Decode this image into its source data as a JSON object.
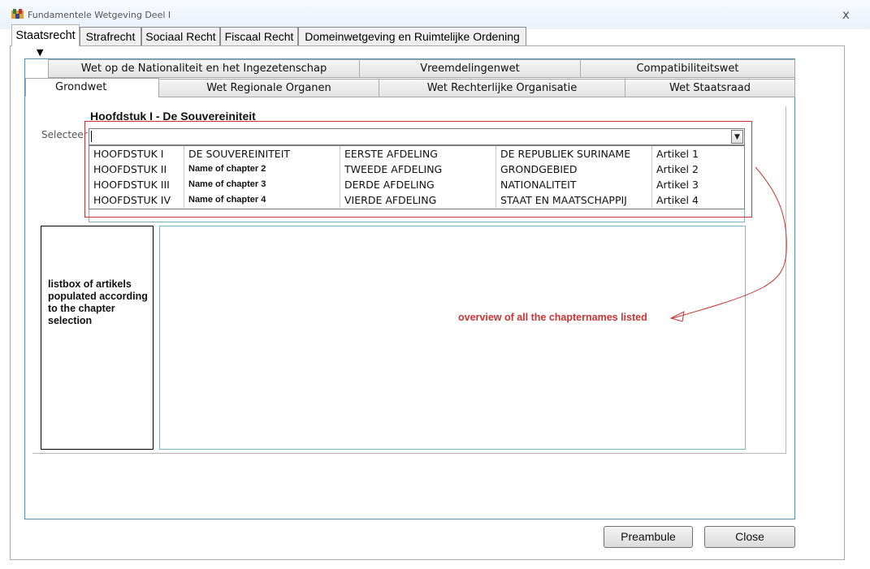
{
  "window": {
    "title": "Fundamentele Wetgeving Deel I",
    "close_glyph": "x"
  },
  "main_tabs": [
    {
      "label": "Staatsrecht"
    },
    {
      "label": "Strafrecht"
    },
    {
      "label": "Sociaal Recht"
    },
    {
      "label": "Fiscaal Recht"
    },
    {
      "label": "Domeinwetgeving en Ruimtelijke Ordening"
    }
  ],
  "arrow_glyph": "▼",
  "sub_tabs_row1": [
    {
      "label": "Wet op de Nationaliteit en het Ingezetenschap"
    },
    {
      "label": "Vreemdelingenwet"
    },
    {
      "label": "Compatibiliteitswet"
    }
  ],
  "sub_tabs_row2": [
    {
      "label": "Grondwet"
    },
    {
      "label": "Wet Regionale Organen"
    },
    {
      "label": "Wet Rechterlijke Organisatie"
    },
    {
      "label": "Wet Staatsraad"
    }
  ],
  "chapter_heading": "Hoofdstuk I - De Souvereiniteit",
  "select_label": "Selecteer",
  "combo_button_glyph": "▼",
  "dropdown_rows": [
    [
      "HOOFDSTUK I",
      "DE SOUVEREINITEIT",
      "EERSTE AFDELING",
      "DE REPUBLIEK SURINAME",
      "Artikel 1"
    ],
    [
      "HOOFDSTUK II",
      "Name of chapter 2",
      "TWEEDE AFDELING",
      "GRONDGEBIED",
      "Artikel 2"
    ],
    [
      "HOOFDSTUK III",
      "Name of chapter 3",
      "DERDE AFDELING",
      "NATIONALITEIT",
      "Artikel 3"
    ],
    [
      "HOOFDSTUK IV",
      "Name of chapter 4",
      "VIERDE AFDELING",
      "STAAT EN MAATSCHAPPIJ",
      "Artikel 4"
    ]
  ],
  "listbox_note": "listbox of artikels populated according to the chapter selection",
  "annotation": "overview of all the chapternames listed",
  "buttons": {
    "preambule": "Preambule",
    "close": "Close"
  },
  "colors": {
    "annotation_red": "#cc3333",
    "frame_blue": "#5a8fb0"
  }
}
